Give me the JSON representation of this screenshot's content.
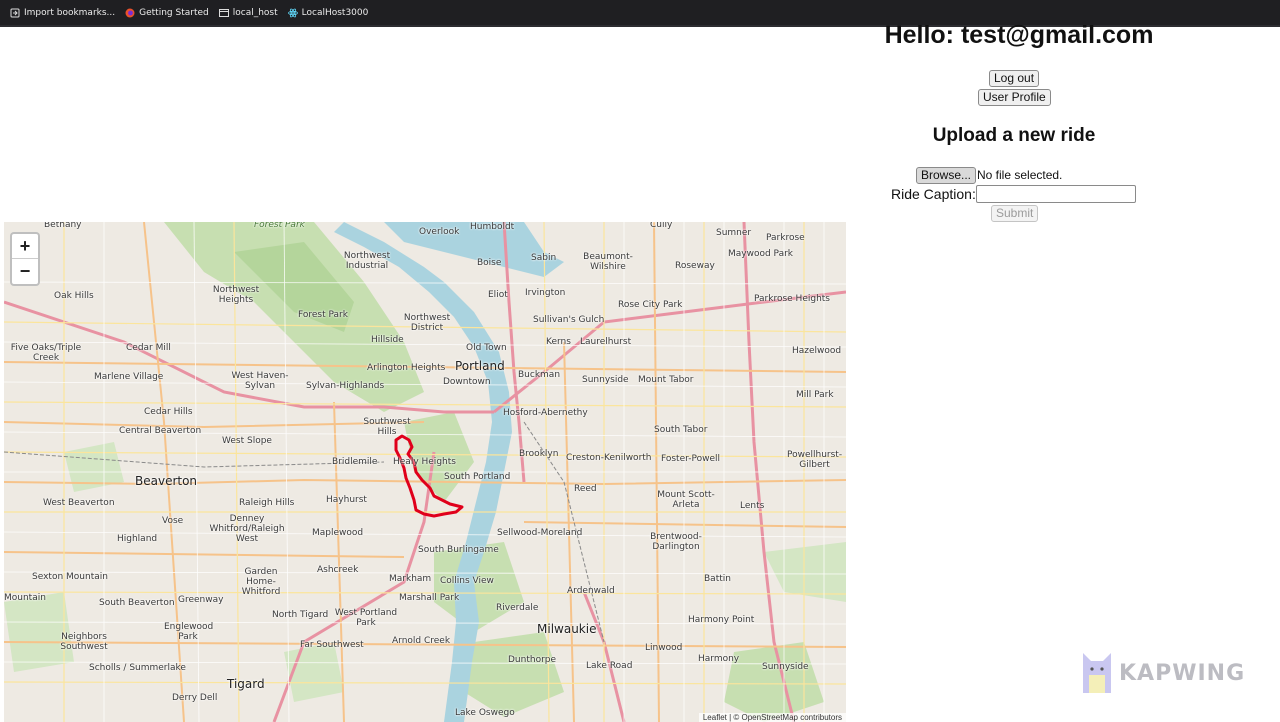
{
  "bookmarks": [
    {
      "label": "Import bookmarks...",
      "icon": "import-icon"
    },
    {
      "label": "Getting Started",
      "icon": "firefox-icon"
    },
    {
      "label": "local_host",
      "icon": "page-icon"
    },
    {
      "label": "LocalHost3000",
      "icon": "react-icon"
    }
  ],
  "header": {
    "greeting": "Hello: test@gmail.com",
    "logout_label": "Log out",
    "profile_label": "User Profile"
  },
  "upload": {
    "title": "Upload a new ride",
    "browse_label": "Browse...",
    "file_status": "No file selected.",
    "caption_label": "Ride Caption:",
    "caption_value": "",
    "submit_label": "Submit"
  },
  "map": {
    "zoom_in": "+",
    "zoom_out": "−",
    "attribution": "Leaflet | © OpenStreetMap contributors",
    "route_color": "#e0001b",
    "places": [
      {
        "name": "Bethany"
      },
      {
        "name": "Forest Park"
      },
      {
        "name": "Overlook"
      },
      {
        "name": "Humboldt"
      },
      {
        "name": "Cully"
      },
      {
        "name": "Sumner"
      },
      {
        "name": "Parkrose"
      },
      {
        "name": "Northwest Industrial"
      },
      {
        "name": "Boise"
      },
      {
        "name": "Sabin"
      },
      {
        "name": "Beaumont-Wilshire"
      },
      {
        "name": "Roseway"
      },
      {
        "name": "Maywood Park"
      },
      {
        "name": "Oak Hills"
      },
      {
        "name": "Northwest Heights"
      },
      {
        "name": "Eliot"
      },
      {
        "name": "Irvington"
      },
      {
        "name": "Rose City Park"
      },
      {
        "name": "Parkrose Heights"
      },
      {
        "name": "Forest Park"
      },
      {
        "name": "Northwest District"
      },
      {
        "name": "Sullivan's Gulch"
      },
      {
        "name": "Five Oaks/Triple Creek"
      },
      {
        "name": "Cedar Mill"
      },
      {
        "name": "Hillside"
      },
      {
        "name": "Old Town"
      },
      {
        "name": "Kerns"
      },
      {
        "name": "Laurelhurst"
      },
      {
        "name": "Hazelwood"
      },
      {
        "name": "Marlene Village"
      },
      {
        "name": "West Haven-Sylvan"
      },
      {
        "name": "Sylvan-Highlands"
      },
      {
        "name": "Arlington Heights"
      },
      {
        "name": "Portland"
      },
      {
        "name": "Downtown"
      },
      {
        "name": "Buckman"
      },
      {
        "name": "Sunnyside"
      },
      {
        "name": "Mount Tabor"
      },
      {
        "name": "Mill Park"
      },
      {
        "name": "Cedar Hills"
      },
      {
        "name": "Hosford-Abernethy"
      },
      {
        "name": "Central Beaverton"
      },
      {
        "name": "West Slope"
      },
      {
        "name": "Southwest Hills"
      },
      {
        "name": "South Tabor"
      },
      {
        "name": "Bridlemile"
      },
      {
        "name": "Healy Heights"
      },
      {
        "name": "Brooklyn"
      },
      {
        "name": "Creston-Kenilworth"
      },
      {
        "name": "Foster-Powell"
      },
      {
        "name": "Powellhurst-Gilbert"
      },
      {
        "name": "Beaverton"
      },
      {
        "name": "South Portland"
      },
      {
        "name": "Reed"
      },
      {
        "name": "Raleigh Hills"
      },
      {
        "name": "Hayhurst"
      },
      {
        "name": "West Beaverton"
      },
      {
        "name": "Mount Scott-Arleta"
      },
      {
        "name": "Lents"
      },
      {
        "name": "Vose"
      },
      {
        "name": "Denney Whitford/Raleigh West"
      },
      {
        "name": "Maplewood"
      },
      {
        "name": "Sellwood-Moreland"
      },
      {
        "name": "Brentwood-Darlington"
      },
      {
        "name": "Highland"
      },
      {
        "name": "South Burlingame"
      },
      {
        "name": "Garden Home-Whitford"
      },
      {
        "name": "Ashcreek"
      },
      {
        "name": "Sexton Mountain"
      },
      {
        "name": "Markham"
      },
      {
        "name": "Collins View"
      },
      {
        "name": "Battin"
      },
      {
        "name": "Marshall Park"
      },
      {
        "name": "Ardenwald"
      },
      {
        "name": "Mountain"
      },
      {
        "name": "South Beaverton"
      },
      {
        "name": "Greenway"
      },
      {
        "name": "North Tigard"
      },
      {
        "name": "West Portland Park"
      },
      {
        "name": "Riverdale"
      },
      {
        "name": "Milwaukie"
      },
      {
        "name": "Harmony Point"
      },
      {
        "name": "Neighbors Southwest"
      },
      {
        "name": "Englewood Park"
      },
      {
        "name": "Arnold Creek"
      },
      {
        "name": "Linwood"
      },
      {
        "name": "Far Southwest"
      },
      {
        "name": "Scholls / Summerlake"
      },
      {
        "name": "Dunthorpe"
      },
      {
        "name": "Lake Road"
      },
      {
        "name": "Harmony"
      },
      {
        "name": "Sunnyside"
      },
      {
        "name": "Tigard"
      },
      {
        "name": "Derry Dell"
      },
      {
        "name": "Lake Oswego"
      }
    ]
  },
  "watermark": {
    "text": "KAPWING"
  }
}
